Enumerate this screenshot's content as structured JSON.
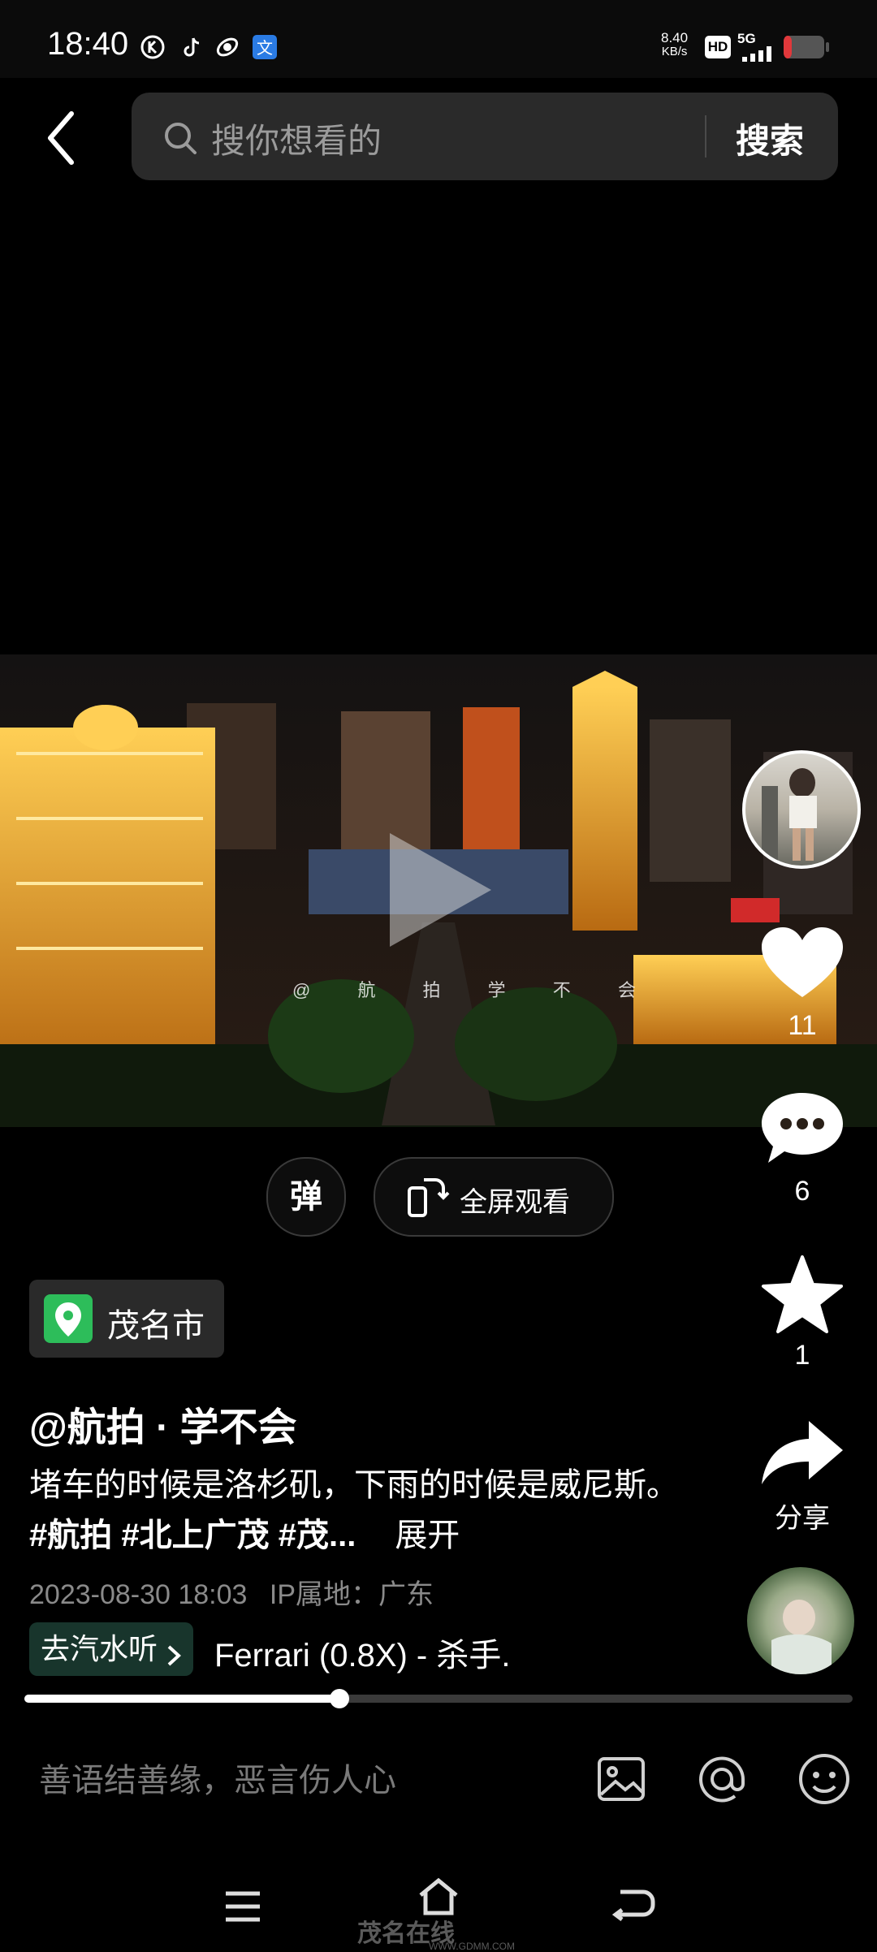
{
  "status_bar": {
    "time": "18:40",
    "net_speed_value": "8.40",
    "net_speed_unit": "KB/s",
    "hd_badge": "HD",
    "network": "5G",
    "app_icons": [
      "k-icon",
      "tiktok-icon",
      "app-icon",
      "translate-icon"
    ],
    "battery_color": "#e0383b"
  },
  "header": {
    "search_placeholder": "搜你想看的",
    "search_button": "搜索"
  },
  "video": {
    "watermark": "@ 航 拍 学 不 会",
    "danmaku_label": "弹",
    "fullscreen_label": "全屏观看"
  },
  "rail": {
    "like_count": "11",
    "comment_count": "6",
    "favorite_count": "1",
    "share_label": "分享"
  },
  "info": {
    "location": "茂名市",
    "author": "@航拍 · 学不会",
    "caption_text": "堵车的时候是洛杉矶，下雨的时候是威尼斯。",
    "caption_tags": "#航拍 #北上广茂 #茂...",
    "expand_label": "展开",
    "date": "2023-08-30 18:03",
    "ip_location": "IP属地：广东",
    "music_tag": "去汽水听",
    "music_title": "Ferrari (0.8X) - 杀手."
  },
  "progress": {
    "fraction": 0.38
  },
  "comment_bar": {
    "placeholder": "善语结善缘，恶言伤人心"
  },
  "watermark_footer": {
    "logo_text": "茂名在线",
    "url": "WWW.GDMM.COM"
  },
  "colors": {
    "accent_green": "#2dbd5a",
    "background": "#000000",
    "search_bg": "#2a2a2a"
  }
}
